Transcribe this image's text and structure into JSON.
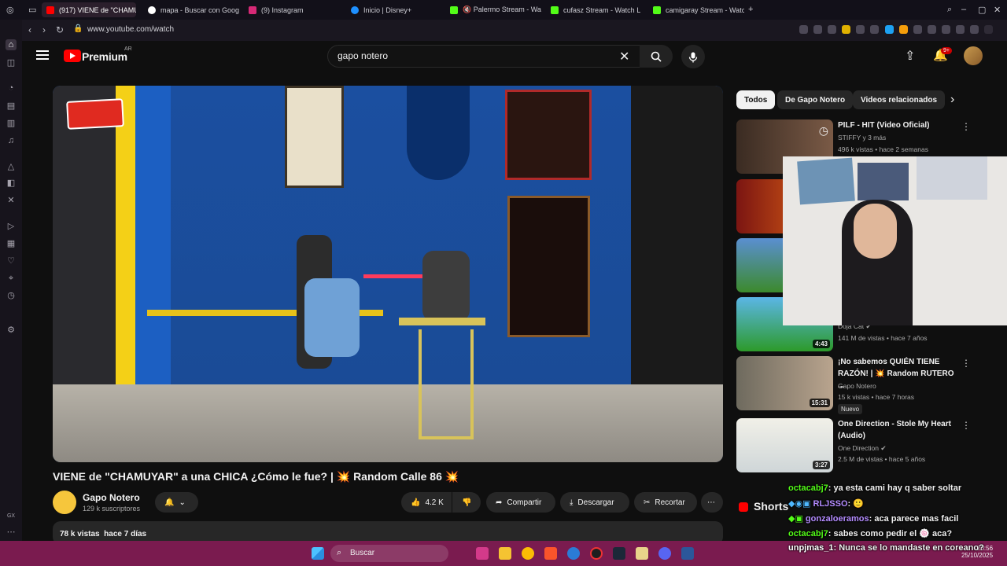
{
  "browser": {
    "tabs": [
      {
        "label": "(917) VIENE de \"CHAMUY",
        "color": "#ff0000",
        "active": true
      },
      {
        "label": "mapa - Buscar con Goog",
        "color": "#ffffff",
        "active": false
      },
      {
        "label": "(9) Instagram",
        "color": "#d62976",
        "active": false
      },
      {
        "label": "Inicio | Disney+",
        "color": "#1e90ff",
        "active": false
      },
      {
        "label": "🔇 Palermo Stream - Wa",
        "color": "#53fc18",
        "active": false
      },
      {
        "label": "cufasz Stream - Watch L",
        "color": "#53fc18",
        "active": false
      },
      {
        "label": "camigaray Stream - Watc",
        "color": "#53fc18",
        "active": false
      }
    ],
    "url": "www.youtube.com/watch"
  },
  "youtube": {
    "brand": "Premium",
    "region": "AR",
    "search_value": "gapo notero",
    "notif_count": "9+"
  },
  "video": {
    "title": "VIENE de \"CHAMUYAR\" a una CHICA ¿Cómo le fue? | 💥 Random Calle 86 💥",
    "channel": "Gapo Notero",
    "subscribers": "129 k suscriptores",
    "likes": "4.2 K",
    "share_label": "Compartir",
    "download_label": "Descargar",
    "clip_label": "Recortar",
    "views": "78 k vistas",
    "age": "hace 7 días"
  },
  "chips": [
    "Todos",
    "De Gapo Notero",
    "Videos relacionados"
  ],
  "recommended": [
    {
      "title": "PILF - HIT (Video Oficial)",
      "channel": "STIFFY y 3 más",
      "meta": "496 k vistas • hace 2 semanas",
      "duration": ""
    },
    {
      "title": "",
      "channel": "",
      "meta": "",
      "duration": ""
    },
    {
      "title": "",
      "channel": "",
      "meta": "",
      "duration": ""
    },
    {
      "title": "",
      "channel": "Doja Cat",
      "meta": "141 M de vistas • hace 7 años",
      "duration": "4:43"
    },
    {
      "title": "¡No sabemos QUIÉN TIENE RAZÓN! | 💥 Random RUTERO ...",
      "channel": "Gapo Notero",
      "meta": "15 k vistas • hace 7 horas",
      "duration": "15:31",
      "badge": "Nuevo"
    },
    {
      "title": "One Direction - Stole My Heart (Audio)",
      "channel": "One Direction",
      "meta": "2.5 M de vistas • hace 5 años",
      "duration": "3:27"
    }
  ],
  "shorts_label": "Shorts",
  "chat": [
    {
      "user": "octacabj7",
      "color": "#53fc18",
      "message": ": ya esta cami hay q saber soltar"
    },
    {
      "user": "RLJSSO",
      "color": "#b48cff",
      "message": ": 🙂"
    },
    {
      "user": "gonzaloeramos",
      "color": "#b48cff",
      "message": ": aca parece mas facil"
    },
    {
      "user": "octacabj7",
      "color": "#53fc18",
      "message": ": sabes como pedir el 🍥 aca?"
    },
    {
      "user": "unpjmas_1",
      "color": "#ffffff",
      "message": ": Nunca se lo mandaste en coreano?"
    }
  ],
  "taskbar": {
    "search_label": "Buscar",
    "time": "20:56",
    "date": "25/10/2025"
  },
  "sidebar": {
    "label_gx": "GX"
  }
}
